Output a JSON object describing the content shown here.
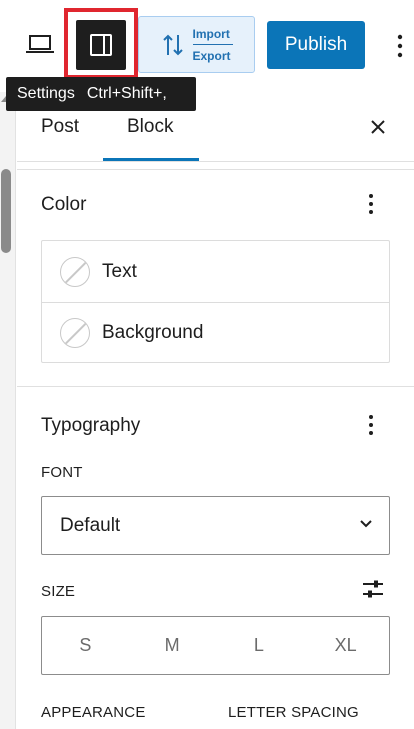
{
  "toolbar": {
    "import_label": "Import",
    "export_label": "Export",
    "publish_label": "Publish"
  },
  "tooltip": {
    "label": "Settings",
    "shortcut": "Ctrl+Shift+,"
  },
  "panel": {
    "tabs": [
      {
        "label": "Post"
      },
      {
        "label": "Block"
      }
    ],
    "active_tab": "Block",
    "color": {
      "title": "Color",
      "items": [
        {
          "label": "Text"
        },
        {
          "label": "Background"
        }
      ]
    },
    "typography": {
      "title": "Typography",
      "font_label": "FONT",
      "font_value": "Default",
      "size_label": "SIZE",
      "size_options": [
        "S",
        "M",
        "L",
        "XL"
      ],
      "appearance_label": "APPEARANCE",
      "letter_spacing_label": "LETTER SPACING"
    }
  },
  "colors": {
    "accent": "#0b75b8",
    "highlight": "#e0262f",
    "text": "#1e1e1e"
  }
}
